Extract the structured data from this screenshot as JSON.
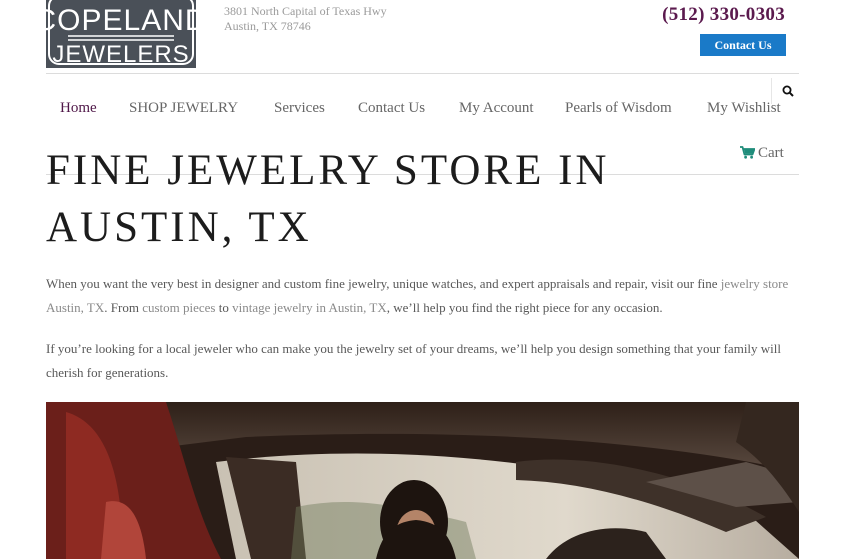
{
  "brand": {
    "line1": "COPELAND",
    "line2": "JEWELERS"
  },
  "address": {
    "line1": "3801 North Capital of Texas Hwy",
    "line2": "Austin, TX 78746"
  },
  "header": {
    "phone": "(512) 330-0303",
    "contact_button": "Contact Us"
  },
  "nav": {
    "items": [
      {
        "label": "Home",
        "active": true
      },
      {
        "label": "SHOP JEWELRY"
      },
      {
        "label": "Services"
      },
      {
        "label": "Contact Us"
      },
      {
        "label": "My Account"
      },
      {
        "label": "Pearls of Wisdom"
      },
      {
        "label": "My Wishlist"
      }
    ],
    "cart_label": "Cart"
  },
  "hero": {
    "title_line1": "FINE JEWELRY STORE IN",
    "title_line2": "AUSTIN, TX"
  },
  "intro": {
    "p1_a": "When you want the very best in designer and custom fine jewelry, unique watches, and expert appraisals and repair, visit our fine ",
    "p1_link1": "jewelry store Austin, TX",
    "p1_b": ". From ",
    "p1_link2": "custom pieces",
    "p1_c": " to ",
    "p1_link3": "vintage jewelry in Austin, TX",
    "p1_d": ", we’ll help you find the right piece for any occasion.",
    "p2": "If you’re looking for a local jeweler who can make you the jewelry set of your dreams, we’ll help you design something that your family will cherish for generations."
  },
  "colors": {
    "brand_plum": "#5b1a4e",
    "button_blue": "#1a7ac8",
    "cart_teal": "#1e8c7a",
    "logo_bg": "#4a5058"
  },
  "icons": [
    "search-icon",
    "cart-icon"
  ]
}
